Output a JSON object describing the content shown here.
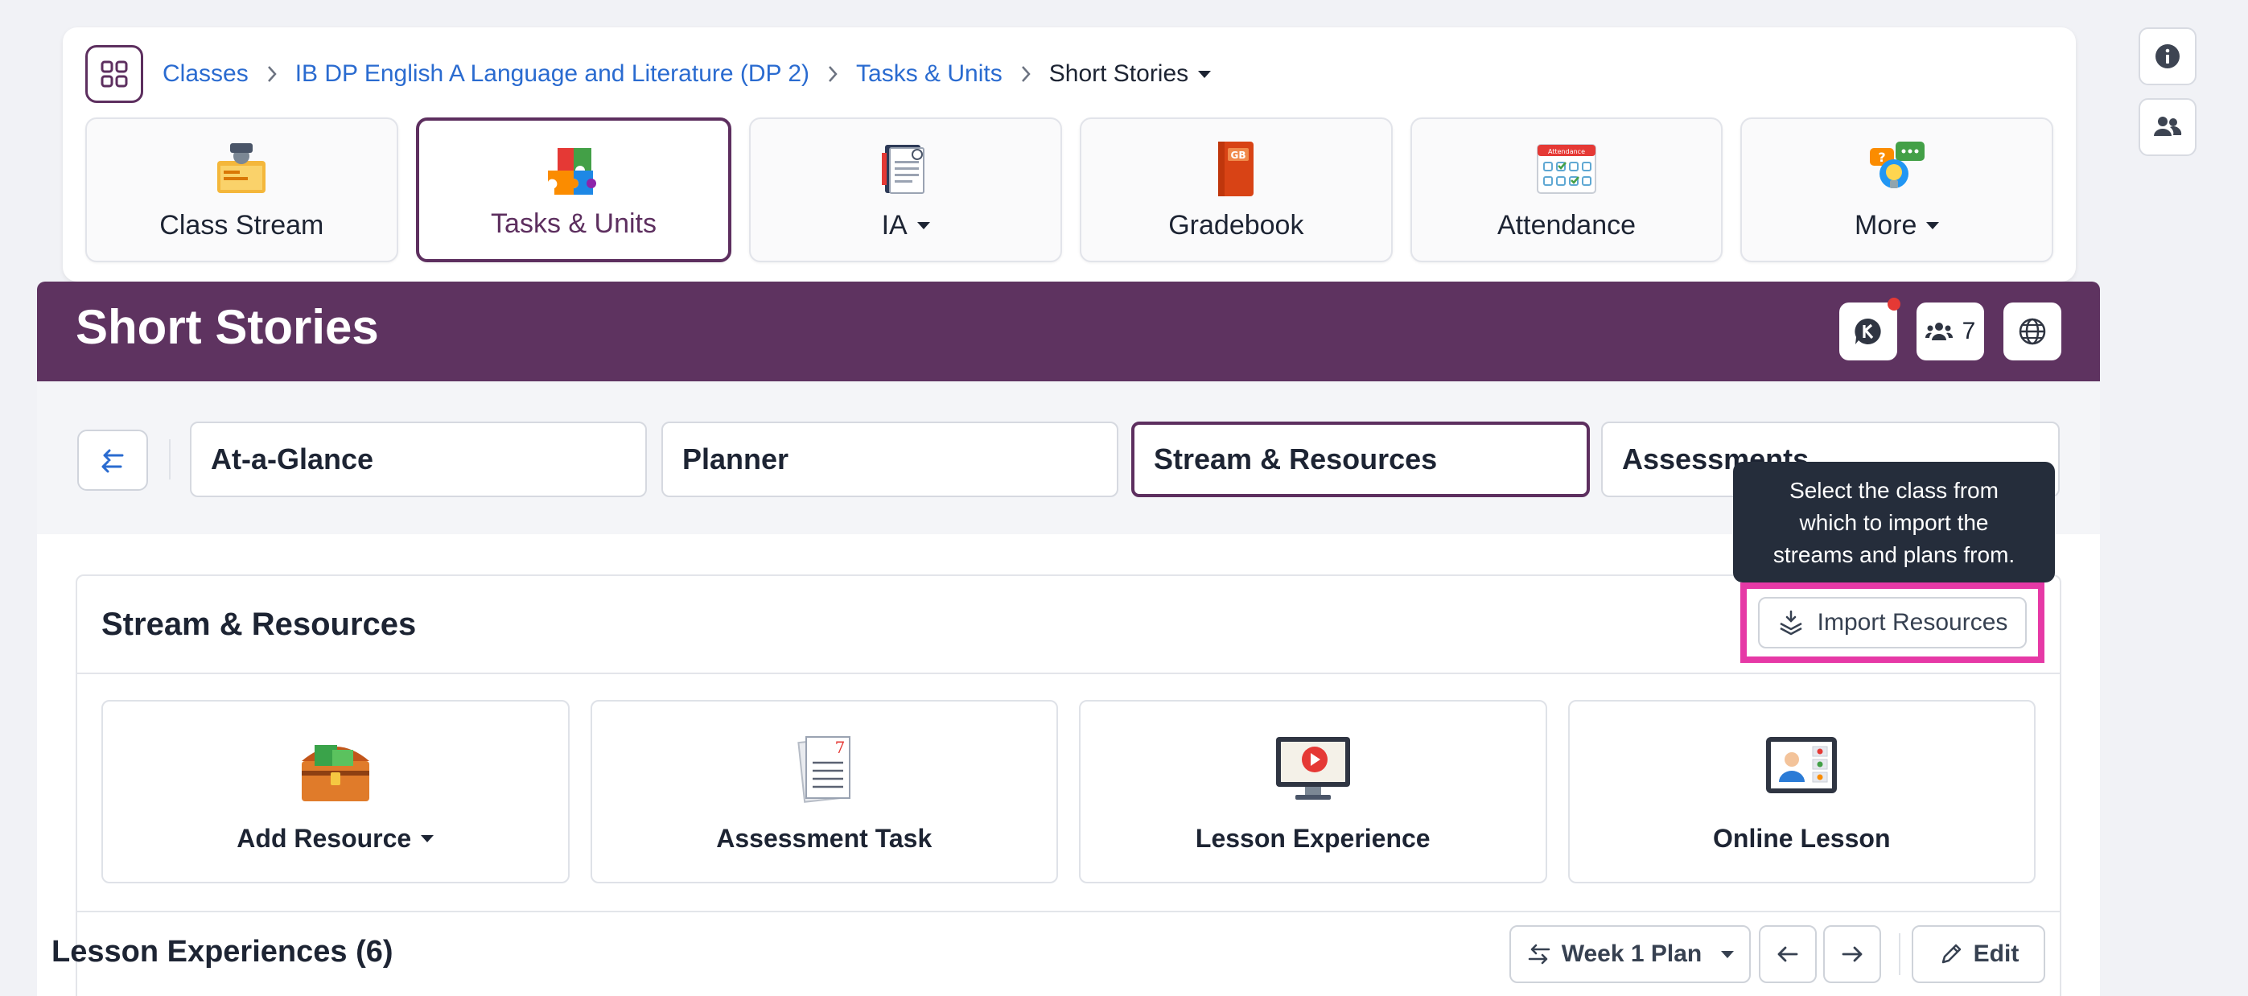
{
  "breadcrumb": {
    "items": [
      "Classes",
      "IB DP English A Language and Literature (DP 2)",
      "Tasks & Units"
    ],
    "current": "Short Stories"
  },
  "modules": [
    {
      "label": "Class Stream",
      "icon": "class-stream-icon"
    },
    {
      "label": "Tasks & Units",
      "icon": "puzzle-icon",
      "active": true
    },
    {
      "label": "IA",
      "icon": "ia-notebook-icon",
      "dropdown": true
    },
    {
      "label": "Gradebook",
      "icon": "gradebook-icon",
      "badge": "GB"
    },
    {
      "label": "Attendance",
      "icon": "attendance-calendar-icon",
      "badge": "Attendance"
    },
    {
      "label": "More",
      "icon": "more-lightbulb-icon",
      "dropdown": true
    }
  ],
  "header": {
    "title": "Short Stories",
    "members_count": "7"
  },
  "tabs": [
    {
      "label": "At-a-Glance"
    },
    {
      "label": "Planner"
    },
    {
      "label": "Stream & Resources",
      "active": true
    },
    {
      "label": "Assessments"
    }
  ],
  "tooltip": {
    "line1": "Select the class from",
    "line2": "which to import the",
    "line3": "streams and plans from."
  },
  "section": {
    "title": "Stream & Resources",
    "import_label": "Import Resources"
  },
  "resources": [
    {
      "label": "Add Resource",
      "icon": "treasure-chest-icon",
      "dropdown": true
    },
    {
      "label": "Assessment Task",
      "icon": "assessment-papers-icon"
    },
    {
      "label": "Lesson Experience",
      "icon": "video-monitor-icon"
    },
    {
      "label": "Online Lesson",
      "icon": "online-lesson-icon"
    }
  ],
  "lessons": {
    "title": "Lesson Experiences (6)",
    "plan_label": "Week 1 Plan",
    "edit_label": "Edit"
  },
  "colors": {
    "brand_purple": "#5e3360",
    "link_blue": "#2a6bd0",
    "highlight_pink": "#e639a6",
    "tooltip_bg": "#252d3b"
  }
}
